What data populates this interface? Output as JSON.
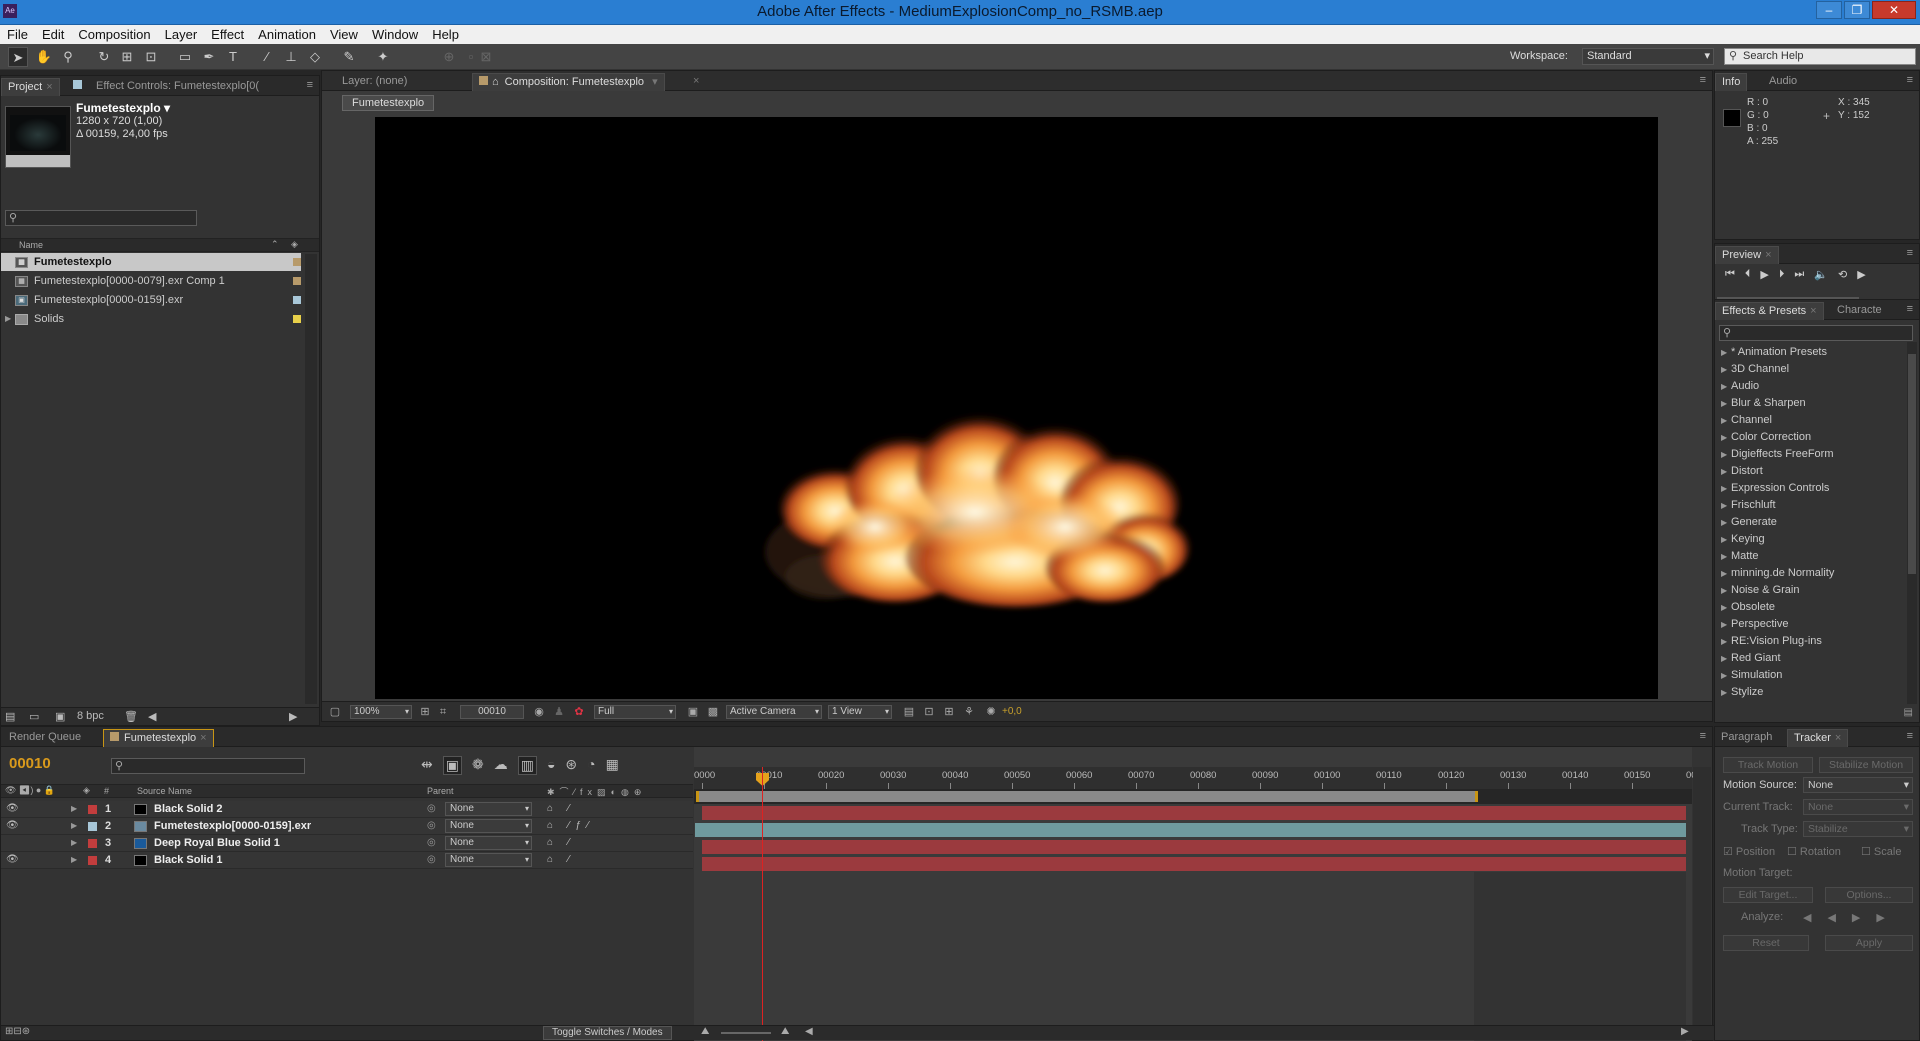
{
  "window": {
    "title": "Adobe After Effects - MediumExplosionComp_no_RSMB.aep",
    "app_icon": "Ae"
  },
  "menu": [
    "File",
    "Edit",
    "Composition",
    "Layer",
    "Effect",
    "Animation",
    "View",
    "Window",
    "Help"
  ],
  "toolbar": {
    "workspace_label": "Workspace:",
    "workspace_value": "Standard",
    "search_help": "Search Help"
  },
  "project": {
    "tabs": {
      "project": "Project",
      "effect_controls": "Effect Controls: Fumetestexplo[0("
    },
    "selected": {
      "name": "Fumetestexplo ▾",
      "size": "1280 x 720 (1,00)",
      "duration": "Δ 00159, 24,00 fps"
    },
    "column_name": "Name",
    "items": [
      {
        "name": "Fumetestexplo",
        "color": "#b79a6a",
        "selected": true
      },
      {
        "name": "Fumetestexplo[0000-0079].exr Comp 1",
        "color": "#b79a6a"
      },
      {
        "name": "Fumetestexplo[0000-0159].exr",
        "color": "#a8c7d8"
      },
      {
        "name": "Solids",
        "color": "#e8d04a"
      }
    ],
    "footer_bpc": "8 bpc"
  },
  "viewer": {
    "layer_tab": "Layer: (none)",
    "comp_tab": "Composition: Fumetestexplo",
    "comp_name": "Fumetestexplo",
    "footer": {
      "zoom": "100%",
      "timecode": "00010",
      "resolution": "Full",
      "camera": "Active Camera",
      "views": "1 View",
      "exposure": "+0,0"
    }
  },
  "info": {
    "tabs": {
      "info": "Info",
      "audio": "Audio"
    },
    "r": "R : 0",
    "g": "G : 0",
    "b": "B : 0",
    "a": "A : 255",
    "x": "X : 345",
    "y": "Y : 152"
  },
  "preview": {
    "tab": "Preview"
  },
  "effects": {
    "tabs": {
      "effects": "Effects & Presets",
      "character": "Characte"
    },
    "items": [
      "* Animation Presets",
      "3D Channel",
      "Audio",
      "Blur & Sharpen",
      "Channel",
      "Color Correction",
      "Digieffects FreeForm",
      "Distort",
      "Expression Controls",
      "Frischluft",
      "Generate",
      "Keying",
      "Matte",
      "minning.de Normality",
      "Noise & Grain",
      "Obsolete",
      "Perspective",
      "RE:Vision Plug-ins",
      "Red Giant",
      "Simulation",
      "Stylize"
    ]
  },
  "timeline": {
    "tabs": {
      "render_queue": "Render Queue",
      "comp": "Fumetestexplo"
    },
    "timecode": "00010",
    "headers": {
      "num": "#",
      "source": "Source Name",
      "parent": "Parent"
    },
    "ruler": [
      "0000",
      "00010",
      "00020",
      "00030",
      "00040",
      "00050",
      "00060",
      "00070",
      "00080",
      "00090",
      "00100",
      "00110",
      "00120",
      "00130",
      "00140",
      "00150",
      "001"
    ],
    "layers": [
      {
        "num": "1",
        "name": "Black Solid 2",
        "parent": "None",
        "label": "#c23d3d",
        "swatch": "#000000",
        "bar": "#9b3a3e"
      },
      {
        "num": "2",
        "name": "Fumetestexplo[0000-0159].exr",
        "parent": "None",
        "label": "#a8c7d8",
        "swatch": "#6a8aa0",
        "bar": "#6f9a9e"
      },
      {
        "num": "3",
        "name": "Deep Royal Blue Solid 1",
        "parent": "None",
        "label": "#c23d3d",
        "swatch": "#1a5a9a",
        "bar": "#9b3a3e"
      },
      {
        "num": "4",
        "name": "Black Solid 1",
        "parent": "None",
        "label": "#c23d3d",
        "swatch": "#000000",
        "bar": "#9b3a3e"
      }
    ],
    "toggle": "Toggle Switches / Modes"
  },
  "tracker": {
    "tabs": {
      "paragraph": "Paragraph",
      "tracker": "Tracker"
    },
    "track_motion": "Track Motion",
    "stabilize_motion": "Stabilize Motion",
    "motion_source_label": "Motion Source:",
    "motion_source_value": "None",
    "current_track_label": "Current Track:",
    "current_track_value": "None",
    "track_type_label": "Track Type:",
    "track_type_value": "Stabilize",
    "position": "Position",
    "rotation": "Rotation",
    "scale": "Scale",
    "motion_target_label": "Motion Target:",
    "edit_target": "Edit Target...",
    "options": "Options...",
    "analyze_label": "Analyze:",
    "reset": "Reset",
    "apply": "Apply"
  }
}
